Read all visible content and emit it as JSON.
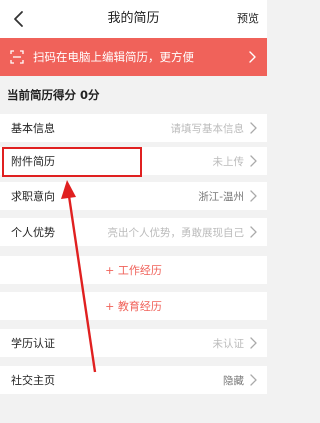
{
  "header": {
    "title": "我的简历",
    "preview_label": "预览"
  },
  "banner": {
    "text": "扫码在电脑上编辑简历，更方便"
  },
  "score": {
    "label": "当前简历得分",
    "value": "0分"
  },
  "rows": {
    "basic_info": {
      "label": "基本信息",
      "value": "请填写基本信息"
    },
    "attachment": {
      "label": "附件简历",
      "value": "未上传"
    },
    "job_intent": {
      "label": "求职意向",
      "value": "浙江-温州"
    },
    "strengths": {
      "label": "个人优势",
      "value": "亮出个人优势，勇敢展现自己"
    },
    "education_cert": {
      "label": "学历认证",
      "value": "未认证"
    },
    "social": {
      "label": "社交主页",
      "value": "隐藏"
    }
  },
  "add_actions": {
    "work": "+ 工作经历",
    "education": "+ 教育经历"
  },
  "colors": {
    "accent": "#f0625a",
    "annotation": "#e02020"
  }
}
